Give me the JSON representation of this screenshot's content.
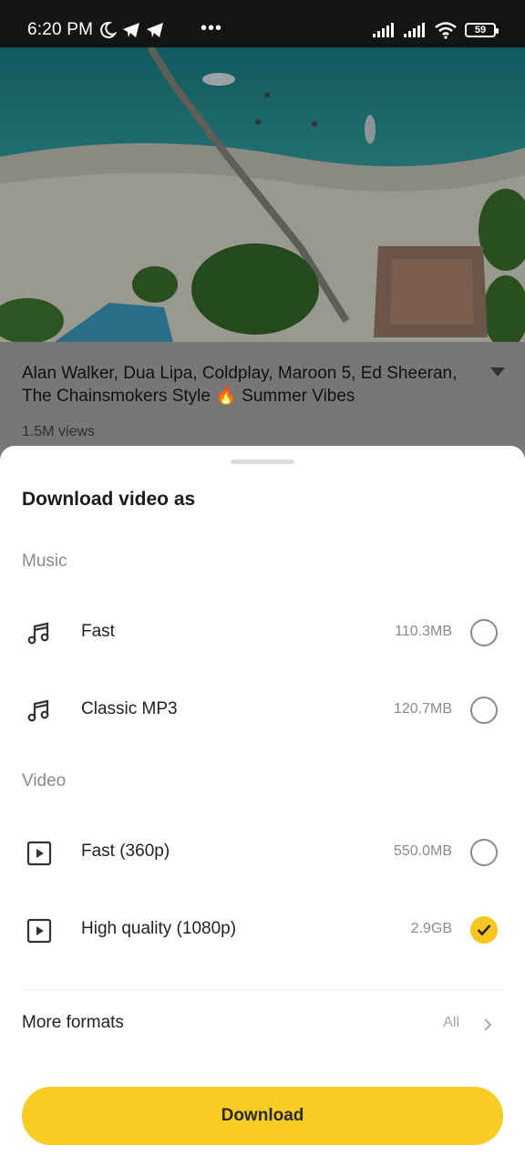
{
  "status_bar": {
    "time": "6:20 PM",
    "icons": [
      "moon-icon",
      "telegram-icon",
      "telegram-icon",
      "more-dots-icon",
      "signal-icon",
      "signal-icon",
      "wifi-icon"
    ],
    "battery": "59"
  },
  "video": {
    "title": "Alan Walker, Dua Lipa, Coldplay, Maroon 5, Ed Sheeran, The Chainsmokers Style 🔥 Summer Vibes",
    "views": "1.5M views"
  },
  "sheet": {
    "title": "Download video as",
    "sections": [
      {
        "label": "Music",
        "options": [
          {
            "label": "Fast",
            "size": "110.3MB",
            "icon": "music-note-icon",
            "selected": false
          },
          {
            "label": "Classic MP3",
            "size": "120.7MB",
            "icon": "music-note-icon",
            "selected": false
          }
        ]
      },
      {
        "label": "Video",
        "options": [
          {
            "label": "Fast (360p)",
            "size": "550.0MB",
            "icon": "play-icon",
            "selected": false
          },
          {
            "label": "High quality (1080p)",
            "size": "2.9GB",
            "icon": "play-icon",
            "selected": true
          }
        ]
      }
    ],
    "more_formats": {
      "label": "More formats",
      "value": "All"
    },
    "download_button": "Download"
  },
  "colors": {
    "accent": "#f9cc26",
    "check": "#f7c71f"
  }
}
